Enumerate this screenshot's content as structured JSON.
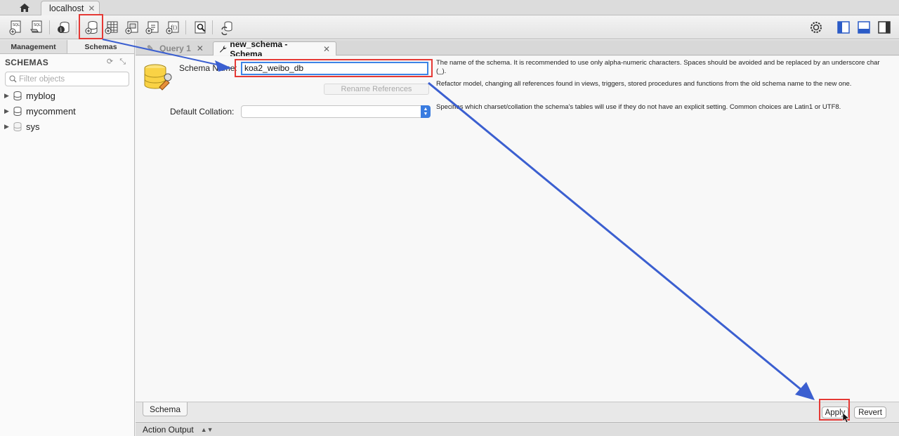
{
  "connection_tab": {
    "label": "localhost",
    "close": "✕"
  },
  "sidebar": {
    "tabs": [
      "Management",
      "Schemas"
    ],
    "header": "SCHEMAS",
    "filter_placeholder": "Filter objects",
    "schemas": [
      "myblog",
      "mycomment",
      "sys"
    ]
  },
  "editor_tabs": {
    "inactive": {
      "label": "Query 1",
      "close": "✕"
    },
    "active": {
      "label": "new_schema - Schema",
      "close": "✕"
    }
  },
  "form": {
    "schema_name_label": "Schema Name:",
    "schema_name_value": "koa2_weibo_db",
    "rename_button": "Rename References",
    "collation_label": "Default Collation:",
    "collation_value": "",
    "help_name": "The name of the schema. It is recommended to use only alpha-numeric characters. Spaces should be avoided and be replaced by an underscore char (_).",
    "help_rename": "Refactor model, changing all references found in views, triggers, stored procedures and functions from the old schema name to the new one.",
    "help_collation": "Specifies which charset/collation the schema's tables will use if they do not have an explicit setting. Common choices are Latin1 or UTF8."
  },
  "bottom": {
    "schema_tab": "Schema",
    "apply": "Apply",
    "revert": "Revert",
    "action_output": "Action Output"
  },
  "colors": {
    "accent_blue": "#3a6fd8",
    "annotation_red": "#e53935",
    "annotation_arrow": "#3b5fd0"
  }
}
